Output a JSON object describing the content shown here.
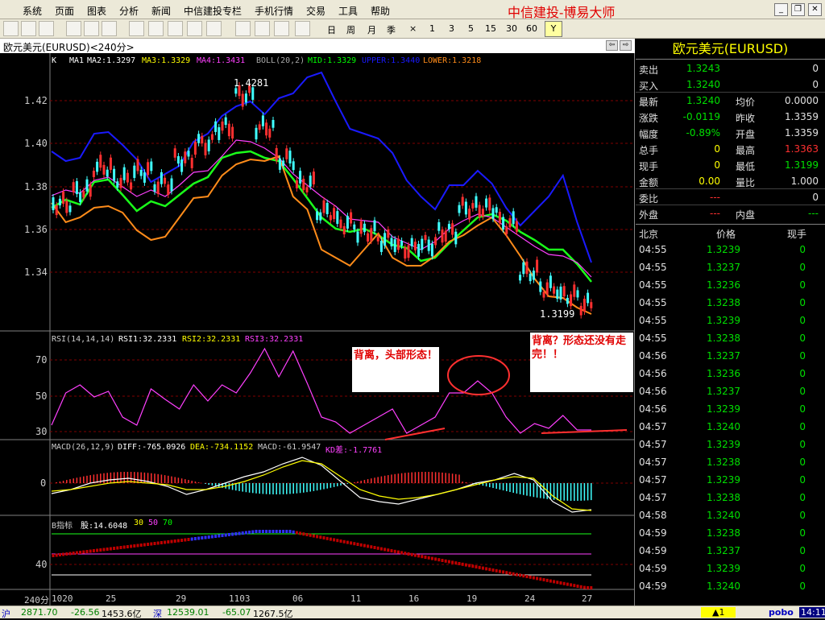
{
  "menu": {
    "items": [
      "系统",
      "页面",
      "图表",
      "分析",
      "新闻",
      "中信建投专栏",
      "手机行情",
      "交易",
      "工具",
      "帮助"
    ],
    "brand": "中信建投-博易大师"
  },
  "toolbar": {
    "periods": [
      "日",
      "周",
      "月",
      "季",
      "×",
      "1",
      "3",
      "5",
      "15",
      "30",
      "60"
    ],
    "active_period": "Y"
  },
  "chart": {
    "title": "欧元美元(EURUSD)<240分>",
    "colors": {
      "blue": "#1a1aff",
      "orange": "#ff8c1a",
      "green": "#1aff1a",
      "magenta": "#ff40ff",
      "white": "#ffffff",
      "yellow": "#ffff00",
      "cyan": "#40ffff",
      "red": "#ff3030",
      "gridred": "#800000"
    },
    "main": {
      "legend": [
        "K",
        "MA1",
        "MA2:1.3297",
        "MA3:1.3329",
        "MA4:1.3431",
        "BOLL(20,2)",
        "MID:1.3329",
        "UPPER:1.3440",
        "LOWER:1.3218"
      ],
      "y_ticks": [
        "1.42",
        "1.40",
        "1.38",
        "1.36",
        "1.34"
      ],
      "high_label": "1.4281",
      "low_label": "1.3199"
    },
    "rsi": {
      "legend": [
        "RSI(14,14,14)",
        "RSI1:32.2331",
        "RSI2:32.2331",
        "RSI3:32.2331"
      ],
      "y_ticks": [
        "70",
        "50",
        "30"
      ],
      "annotations": [
        "背离，头部形态！",
        "背离？形态还没有走完！！"
      ]
    },
    "macd": {
      "legend": [
        "MACD(26,12,9)",
        "DIFF:-765.0926",
        "DEA:-734.1152",
        "MACD:-61.9547",
        "KD差:-1.7761"
      ],
      "y_ticks": [
        "0"
      ]
    },
    "b": {
      "legend": [
        "B指标",
        "股:14.6048",
        "30",
        "50",
        "70"
      ],
      "y_ticks": [
        "40"
      ]
    },
    "x_axis": {
      "period": "240分",
      "labels": [
        "1020",
        "25",
        "29",
        "1103",
        "06",
        "11",
        "16",
        "19",
        "24",
        "27"
      ]
    }
  },
  "quote": {
    "title": "欧元美元(EURUSD)",
    "rows": [
      {
        "l1": "卖出",
        "v1": "1.3243",
        "l2": "",
        "v2": "0"
      },
      {
        "l1": "买入",
        "v1": "1.3240",
        "l2": "",
        "v2": "0"
      },
      {
        "l1": "最新",
        "v1": "1.3240",
        "l2": "均价",
        "v2": "0.0000"
      },
      {
        "l1": "涨跌",
        "v1": "-0.0119",
        "l2": "昨收",
        "v2": "1.3359"
      },
      {
        "l1": "幅度",
        "v1": "-0.89%",
        "l2": "开盘",
        "v2": "1.3359"
      },
      {
        "l1": "总手",
        "v1": "0",
        "l2": "最高",
        "v2": "1.3363"
      },
      {
        "l1": "现手",
        "v1": "0",
        "l2": "最低",
        "v2": "1.3199"
      },
      {
        "l1": "金额",
        "v1": "0.00",
        "l2": "量比",
        "v2": "1.000"
      },
      {
        "l1": "委比",
        "v1": "---",
        "l2": "",
        "v2": "0"
      },
      {
        "l1": "外盘",
        "v1": "---",
        "l2": "内盘",
        "v2": "---"
      }
    ],
    "tick_headers": [
      "北京",
      "价格",
      "现手"
    ],
    "ticks": [
      {
        "time": "04:55",
        "price": "1.3239",
        "vol": "0"
      },
      {
        "time": "04:55",
        "price": "1.3237",
        "vol": "0"
      },
      {
        "time": "04:55",
        "price": "1.3236",
        "vol": "0"
      },
      {
        "time": "04:55",
        "price": "1.3238",
        "vol": "0"
      },
      {
        "time": "04:55",
        "price": "1.3239",
        "vol": "0"
      },
      {
        "time": "04:55",
        "price": "1.3238",
        "vol": "0"
      },
      {
        "time": "04:56",
        "price": "1.3237",
        "vol": "0"
      },
      {
        "time": "04:56",
        "price": "1.3236",
        "vol": "0"
      },
      {
        "time": "04:56",
        "price": "1.3237",
        "vol": "0"
      },
      {
        "time": "04:56",
        "price": "1.3239",
        "vol": "0"
      },
      {
        "time": "04:57",
        "price": "1.3240",
        "vol": "0"
      },
      {
        "time": "04:57",
        "price": "1.3239",
        "vol": "0"
      },
      {
        "time": "04:57",
        "price": "1.3238",
        "vol": "0"
      },
      {
        "time": "04:57",
        "price": "1.3239",
        "vol": "0"
      },
      {
        "time": "04:57",
        "price": "1.3238",
        "vol": "0"
      },
      {
        "time": "04:58",
        "price": "1.3240",
        "vol": "0"
      },
      {
        "time": "04:59",
        "price": "1.3238",
        "vol": "0"
      },
      {
        "time": "04:59",
        "price": "1.3237",
        "vol": "0"
      },
      {
        "time": "04:59",
        "price": "1.3239",
        "vol": "0"
      },
      {
        "time": "04:59",
        "price": "1.3240",
        "vol": "0"
      }
    ]
  },
  "status": {
    "sh_label": "沪",
    "sh_index": "2871.70",
    "sh_change": "-26.56",
    "sh_amount": "1453.6亿",
    "sz_label": "深",
    "sz_index": "12539.01",
    "sz_change": "-65.07",
    "sz_amount": "1267.5亿",
    "alert": "▲1",
    "brand": "pobo",
    "time": "14:11"
  }
}
